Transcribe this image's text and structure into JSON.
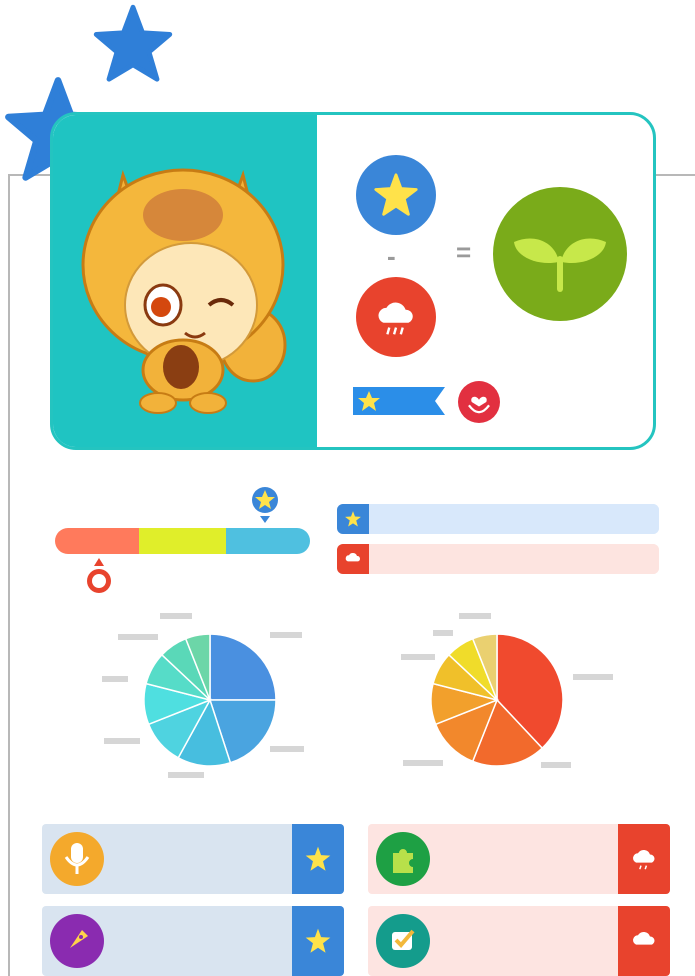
{
  "colors": {
    "teal": "#1fc4c2",
    "star_blue": "#3a86d8",
    "rain_red": "#e8432d",
    "plant_green": "#7aab1a",
    "gauge": [
      "#ff7a5c",
      "#e0ee2a",
      "#4fc0e0"
    ],
    "blue_pale": "#d8e8fb",
    "red_pale": "#fde4e0",
    "blue_card": "#d9e4f0",
    "red_card": "#fde4e1"
  },
  "hero": {
    "minus_label": "-",
    "equals_label": "="
  },
  "gauge": {
    "segments": [
      0.33,
      0.34,
      0.33
    ],
    "star_pin": 0.82,
    "rain_pin": 0.17
  },
  "tracks": [
    {
      "kind": "star",
      "fill": 1.0
    },
    {
      "kind": "rain",
      "fill": 1.0
    }
  ],
  "pies": [
    {
      "name": "star-pie",
      "slices": [
        0.25,
        0.2,
        0.13,
        0.11,
        0.1,
        0.08,
        0.07,
        0.06
      ],
      "colors": [
        "#4a90e0",
        "#4aa4e0",
        "#47bedf",
        "#4fd3e0",
        "#4fdfe0",
        "#56dcc8",
        "#5ad8b8",
        "#6cd6a8"
      ]
    },
    {
      "name": "rain-pie",
      "slices": [
        0.38,
        0.18,
        0.13,
        0.1,
        0.08,
        0.07,
        0.06
      ],
      "colors": [
        "#f04a2e",
        "#f26a2c",
        "#f2882c",
        "#f2a02c",
        "#f0c02a",
        "#f0dc2a",
        "#ead070"
      ]
    }
  ],
  "cards": [
    {
      "name": "microphone",
      "icon": "microphone-icon",
      "side": "star",
      "color": "#f4a92c"
    },
    {
      "name": "puzzle",
      "icon": "puzzle-icon",
      "side": "rain",
      "color": "#1ea044"
    },
    {
      "name": "rocket",
      "icon": "rocket-icon",
      "side": "star",
      "color": "#8a2bb0"
    },
    {
      "name": "checkmark",
      "icon": "checkmark-icon",
      "side": "rain",
      "color": "#149c8c"
    }
  ]
}
